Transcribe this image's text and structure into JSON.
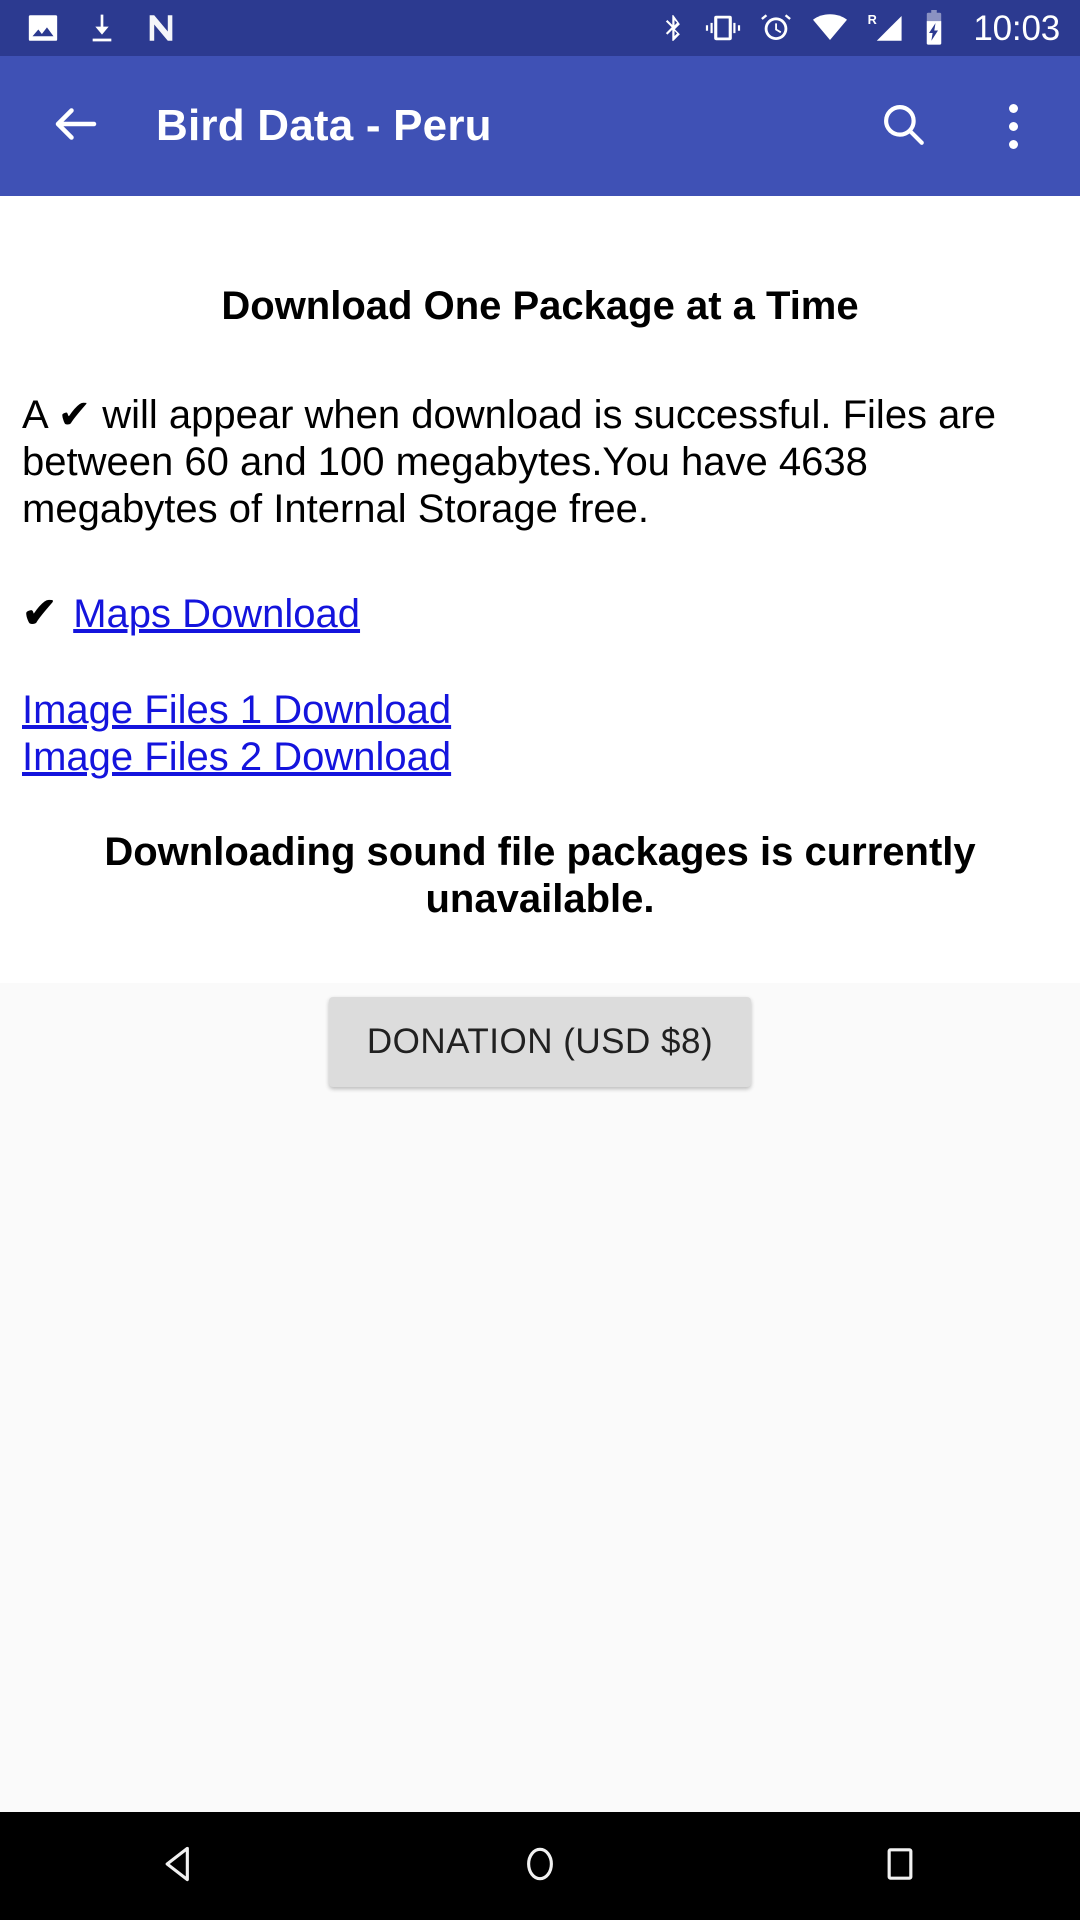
{
  "status_bar": {
    "background": "#2c3a90",
    "clock": "10:03",
    "left_icons": [
      {
        "name": "photo-icon",
        "label": "Screenshot"
      },
      {
        "name": "download-icon",
        "label": "Download"
      },
      {
        "name": "android-nougat-icon",
        "label": "N"
      }
    ],
    "right_icons": [
      {
        "name": "bluetooth-icon",
        "label": "Bluetooth"
      },
      {
        "name": "vibrate-icon",
        "label": "Vibrate"
      },
      {
        "name": "alarm-icon",
        "label": "Alarm"
      },
      {
        "name": "wifi-icon",
        "label": "Wi-Fi"
      },
      {
        "name": "cellular-signal-roaming-icon",
        "label": "R"
      },
      {
        "name": "battery-charging-icon",
        "label": "Charging"
      }
    ]
  },
  "app_bar": {
    "background": "#3f51b5",
    "title": "Bird Data - Peru",
    "back_label": "Navigate up",
    "search_label": "Search",
    "overflow_label": "More options"
  },
  "main": {
    "heading": "Download One Package at a Time",
    "intro": "A ✔ will appear when download is successful. Files are between 60 and 100 megabytes.You have 4638 megabytes of Internal Storage free.",
    "downloaded_check": "✔",
    "links": [
      {
        "label": "Maps Download",
        "downloaded": true
      },
      {
        "label": "Image Files 1 Download",
        "downloaded": false
      },
      {
        "label": "Image Files 2 Download",
        "downloaded": false
      }
    ],
    "link_color": "#1414dd",
    "notice": "Downloading sound file packages is currently unavailable.",
    "donation_button": "DONATION (USD $8)",
    "panel_background": "#fafafa"
  },
  "nav_bar": {
    "background": "#000000",
    "buttons": [
      {
        "name": "nav-back-button",
        "label": "Back"
      },
      {
        "name": "nav-home-button",
        "label": "Home"
      },
      {
        "name": "nav-recents-button",
        "label": "Recents"
      }
    ]
  }
}
